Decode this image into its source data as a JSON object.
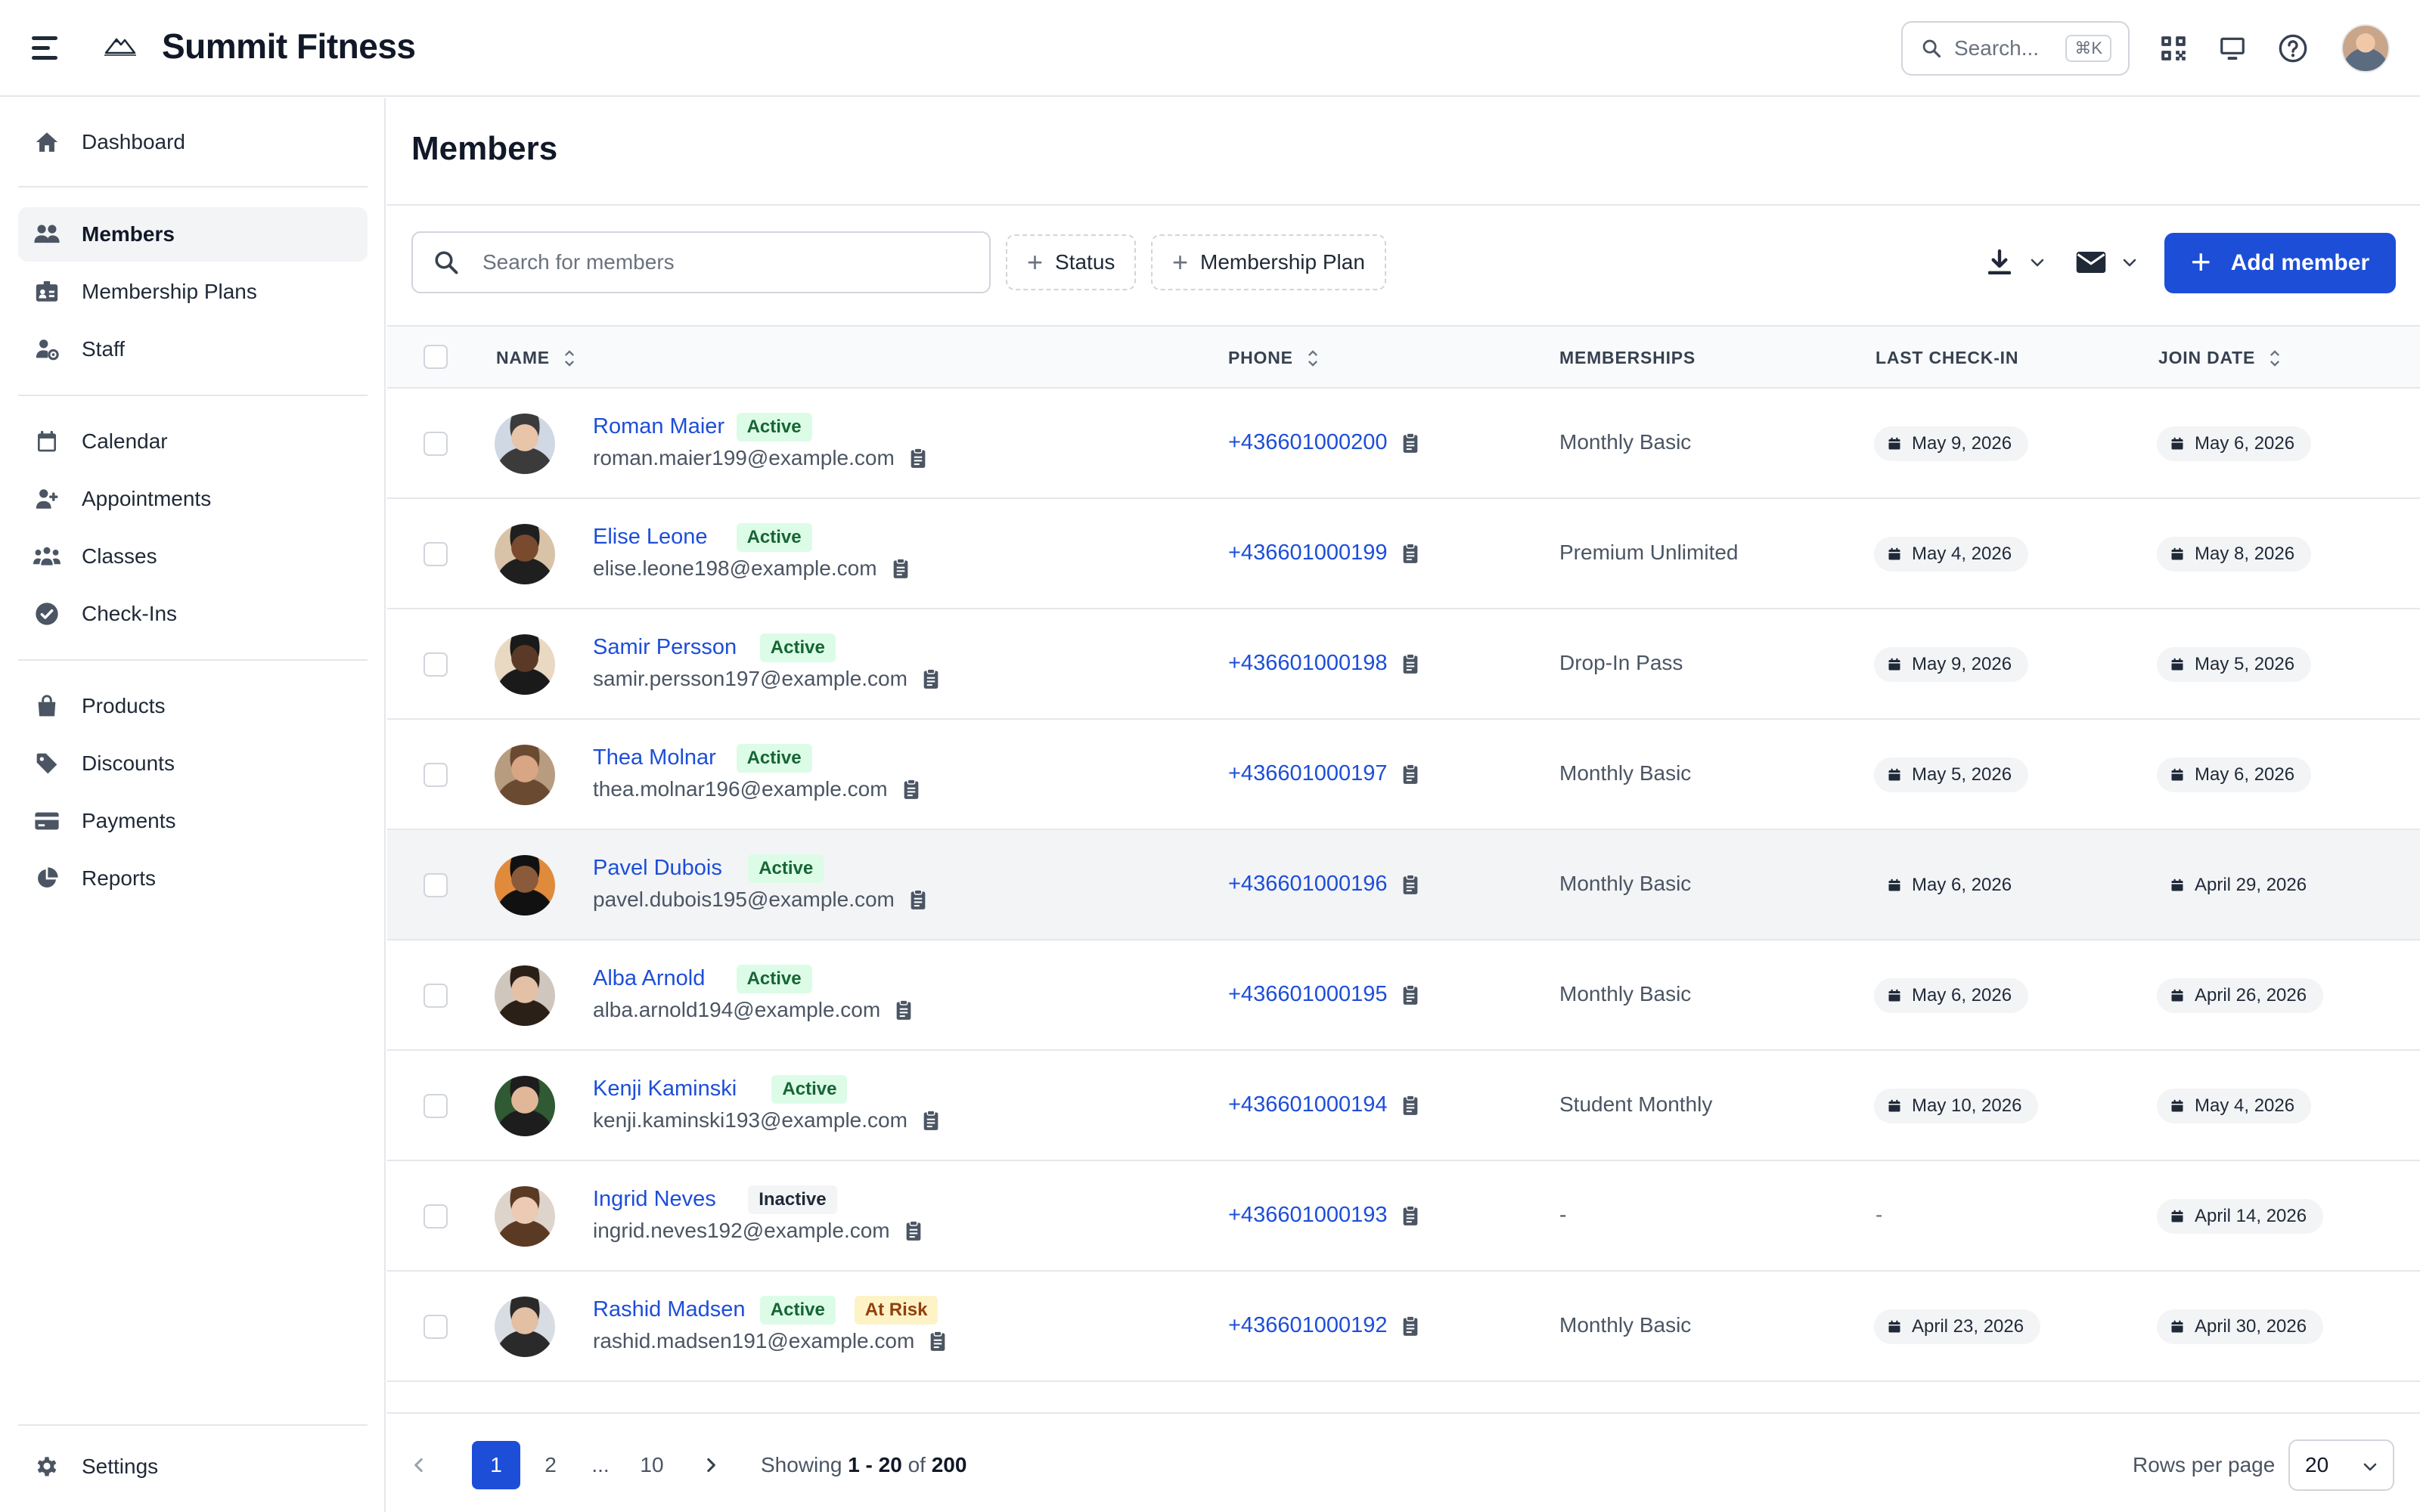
{
  "app": {
    "brand": "Summit Fitness"
  },
  "header": {
    "search_placeholder": "Search...",
    "search_shortcut": "⌘K"
  },
  "sidebar": {
    "items": [
      {
        "label": "Dashboard",
        "icon": "home-icon"
      },
      {
        "label": "Members",
        "icon": "users-icon",
        "active": true
      },
      {
        "label": "Membership Plans",
        "icon": "id-card-icon"
      },
      {
        "label": "Staff",
        "icon": "user-gear-icon"
      },
      {
        "label": "Calendar",
        "icon": "calendar-icon"
      },
      {
        "label": "Appointments",
        "icon": "user-plus-icon"
      },
      {
        "label": "Classes",
        "icon": "group-icon"
      },
      {
        "label": "Check-Ins",
        "icon": "check-circle-icon"
      },
      {
        "label": "Products",
        "icon": "shopping-bag-icon"
      },
      {
        "label": "Discounts",
        "icon": "tag-icon"
      },
      {
        "label": "Payments",
        "icon": "credit-card-icon"
      },
      {
        "label": "Reports",
        "icon": "pie-chart-icon"
      }
    ],
    "settings": "Settings"
  },
  "main": {
    "title": "Members",
    "search_placeholder": "Search for members",
    "filters": {
      "status": "Status",
      "plan": "Membership Plan"
    },
    "add_button": "Add member",
    "columns": {
      "name": "NAME",
      "phone": "PHONE",
      "memberships": "MEMBERSHIPS",
      "last_checkin": "LAST CHECK-IN",
      "join_date": "JOIN DATE"
    },
    "rows": [
      {
        "name": "Roman Maier",
        "status": "Active",
        "email": "roman.maier199@example.com",
        "phone": "+436601000200",
        "plan": "Monthly Basic",
        "last": "May 9, 2026",
        "join": "May 6, 2026"
      },
      {
        "name": "Elise Leone",
        "status": "Active",
        "email": "elise.leone198@example.com",
        "phone": "+436601000199",
        "plan": "Premium Unlimited",
        "last": "May 4, 2026",
        "join": "May 8, 2026"
      },
      {
        "name": "Samir Persson",
        "status": "Active",
        "email": "samir.persson197@example.com",
        "phone": "+436601000198",
        "plan": "Drop-In Pass",
        "last": "May 9, 2026",
        "join": "May 5, 2026"
      },
      {
        "name": "Thea Molnar",
        "status": "Active",
        "email": "thea.molnar196@example.com",
        "phone": "+436601000197",
        "plan": "Monthly Basic",
        "last": "May 5, 2026",
        "join": "May 6, 2026"
      },
      {
        "name": "Pavel Dubois",
        "status": "Active",
        "email": "pavel.dubois195@example.com",
        "phone": "+436601000196",
        "plan": "Monthly Basic",
        "last": "May 6, 2026",
        "join": "April 29, 2026"
      },
      {
        "name": "Alba Arnold",
        "status": "Active",
        "email": "alba.arnold194@example.com",
        "phone": "+436601000195",
        "plan": "Monthly Basic",
        "last": "May 6, 2026",
        "join": "April 26, 2026"
      },
      {
        "name": "Kenji Kaminski",
        "status": "Active",
        "email": "kenji.kaminski193@example.com",
        "phone": "+436601000194",
        "plan": "Student Monthly",
        "last": "May 10, 2026",
        "join": "May 4, 2026"
      },
      {
        "name": "Ingrid Neves",
        "status": "Inactive",
        "email": "ingrid.neves192@example.com",
        "phone": "+436601000193",
        "plan": "-",
        "last": "-",
        "join": "April 14, 2026"
      },
      {
        "name": "Rashid Madsen",
        "status": "Active",
        "extra": "At Risk",
        "email": "rashid.madsen191@example.com",
        "phone": "+436601000192",
        "plan": "Monthly Basic",
        "last": "April 23, 2026",
        "join": "April 30, 2026"
      }
    ]
  },
  "pagination": {
    "pages": [
      "1",
      "2",
      "...",
      "10"
    ],
    "current": "1",
    "showing_prefix": "Showing",
    "showing_range": "1 - 20",
    "showing_of": "of",
    "showing_total": "200",
    "rows_per_page_label": "Rows per page",
    "rows_per_page": "20"
  },
  "colors": {
    "accent": "#1d4ed8",
    "active_bg": "#dcfce7",
    "active_fg": "#166534",
    "risk_bg": "#fef3c7",
    "risk_fg": "#92400e"
  }
}
